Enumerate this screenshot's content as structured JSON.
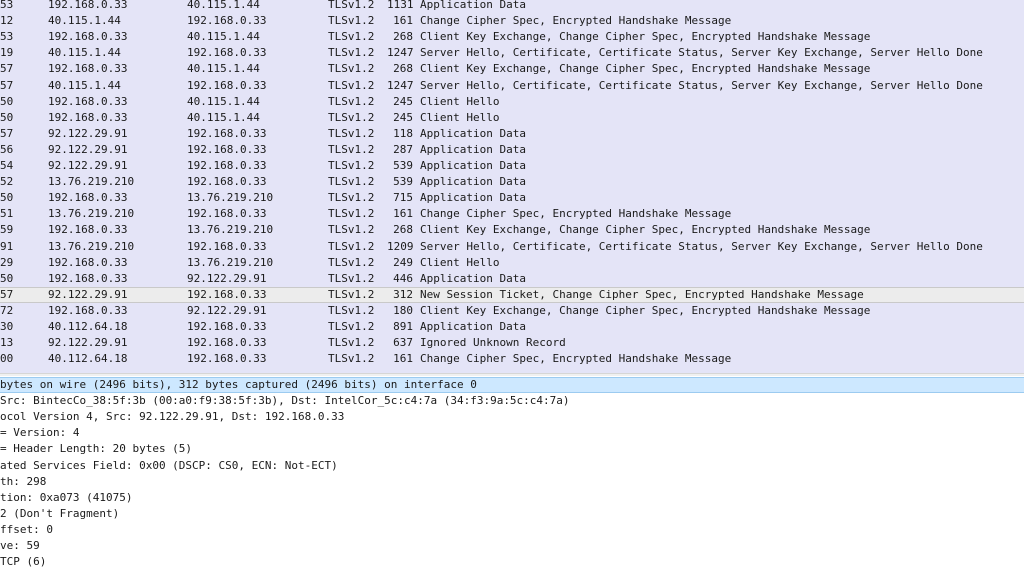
{
  "packet_list": {
    "rows": [
      {
        "no": "53",
        "src": "192.168.0.33",
        "dst": "40.115.1.44",
        "proto": "TLSv1.2",
        "len": "1131",
        "info": "Application Data"
      },
      {
        "no": "12",
        "src": "40.115.1.44",
        "dst": "192.168.0.33",
        "proto": "TLSv1.2",
        "len": "161",
        "info": "Change Cipher Spec, Encrypted Handshake Message"
      },
      {
        "no": "53",
        "src": "192.168.0.33",
        "dst": "40.115.1.44",
        "proto": "TLSv1.2",
        "len": "268",
        "info": "Client Key Exchange, Change Cipher Spec, Encrypted Handshake Message"
      },
      {
        "no": "19",
        "src": "40.115.1.44",
        "dst": "192.168.0.33",
        "proto": "TLSv1.2",
        "len": "1247",
        "info": "Server Hello, Certificate, Certificate Status, Server Key Exchange, Server Hello Done"
      },
      {
        "no": "57",
        "src": "192.168.0.33",
        "dst": "40.115.1.44",
        "proto": "TLSv1.2",
        "len": "268",
        "info": "Client Key Exchange, Change Cipher Spec, Encrypted Handshake Message"
      },
      {
        "no": "57",
        "src": "40.115.1.44",
        "dst": "192.168.0.33",
        "proto": "TLSv1.2",
        "len": "1247",
        "info": "Server Hello, Certificate, Certificate Status, Server Key Exchange, Server Hello Done"
      },
      {
        "no": "50",
        "src": "192.168.0.33",
        "dst": "40.115.1.44",
        "proto": "TLSv1.2",
        "len": "245",
        "info": "Client Hello"
      },
      {
        "no": "50",
        "src": "192.168.0.33",
        "dst": "40.115.1.44",
        "proto": "TLSv1.2",
        "len": "245",
        "info": "Client Hello"
      },
      {
        "no": "57",
        "src": "92.122.29.91",
        "dst": "192.168.0.33",
        "proto": "TLSv1.2",
        "len": "118",
        "info": "Application Data"
      },
      {
        "no": "56",
        "src": "92.122.29.91",
        "dst": "192.168.0.33",
        "proto": "TLSv1.2",
        "len": "287",
        "info": "Application Data"
      },
      {
        "no": "54",
        "src": "92.122.29.91",
        "dst": "192.168.0.33",
        "proto": "TLSv1.2",
        "len": "539",
        "info": "Application Data"
      },
      {
        "no": "52",
        "src": "13.76.219.210",
        "dst": "192.168.0.33",
        "proto": "TLSv1.2",
        "len": "539",
        "info": "Application Data"
      },
      {
        "no": "50",
        "src": "192.168.0.33",
        "dst": "13.76.219.210",
        "proto": "TLSv1.2",
        "len": "715",
        "info": "Application Data"
      },
      {
        "no": "51",
        "src": "13.76.219.210",
        "dst": "192.168.0.33",
        "proto": "TLSv1.2",
        "len": "161",
        "info": "Change Cipher Spec, Encrypted Handshake Message"
      },
      {
        "no": "59",
        "src": "192.168.0.33",
        "dst": "13.76.219.210",
        "proto": "TLSv1.2",
        "len": "268",
        "info": "Client Key Exchange, Change Cipher Spec, Encrypted Handshake Message"
      },
      {
        "no": "91",
        "src": "13.76.219.210",
        "dst": "192.168.0.33",
        "proto": "TLSv1.2",
        "len": "1209",
        "info": "Server Hello, Certificate, Certificate Status, Server Key Exchange, Server Hello Done"
      },
      {
        "no": "29",
        "src": "192.168.0.33",
        "dst": "13.76.219.210",
        "proto": "TLSv1.2",
        "len": "249",
        "info": "Client Hello"
      },
      {
        "no": "50",
        "src": "192.168.0.33",
        "dst": "92.122.29.91",
        "proto": "TLSv1.2",
        "len": "446",
        "info": "Application Data"
      },
      {
        "no": "57",
        "src": "92.122.29.91",
        "dst": "192.168.0.33",
        "proto": "TLSv1.2",
        "len": "312",
        "info": "New Session Ticket, Change Cipher Spec, Encrypted Handshake Message"
      },
      {
        "no": "72",
        "src": "192.168.0.33",
        "dst": "92.122.29.91",
        "proto": "TLSv1.2",
        "len": "180",
        "info": "Client Key Exchange, Change Cipher Spec, Encrypted Handshake Message"
      },
      {
        "no": "30",
        "src": "40.112.64.18",
        "dst": "192.168.0.33",
        "proto": "TLSv1.2",
        "len": "891",
        "info": "Application Data"
      },
      {
        "no": "13",
        "src": "92.122.29.91",
        "dst": "192.168.0.33",
        "proto": "TLSv1.2",
        "len": "637",
        "info": "Ignored Unknown Record"
      },
      {
        "no": "00",
        "src": "40.112.64.18",
        "dst": "192.168.0.33",
        "proto": "TLSv1.2",
        "len": "161",
        "info": "Change Cipher Spec, Encrypted Handshake Message"
      }
    ]
  },
  "details": {
    "lines": [
      "bytes on wire (2496 bits), 312 bytes captured (2496 bits) on interface 0",
      "Src: BintecCo_38:5f:3b (00:a0:f9:38:5f:3b), Dst: IntelCor_5c:c4:7a (34:f3:9a:5c:c4:7a)",
      "ocol Version 4, Src: 92.122.29.91, Dst: 192.168.0.33",
      "= Version: 4",
      "= Header Length: 20 bytes (5)",
      "ated Services Field: 0x00 (DSCP: CS0, ECN: Not-ECT)",
      "th: 298",
      "tion: 0xa073 (41075)",
      "2 (Don't Fragment)",
      "ffset: 0",
      "ve: 59",
      "TCP (6)"
    ]
  }
}
